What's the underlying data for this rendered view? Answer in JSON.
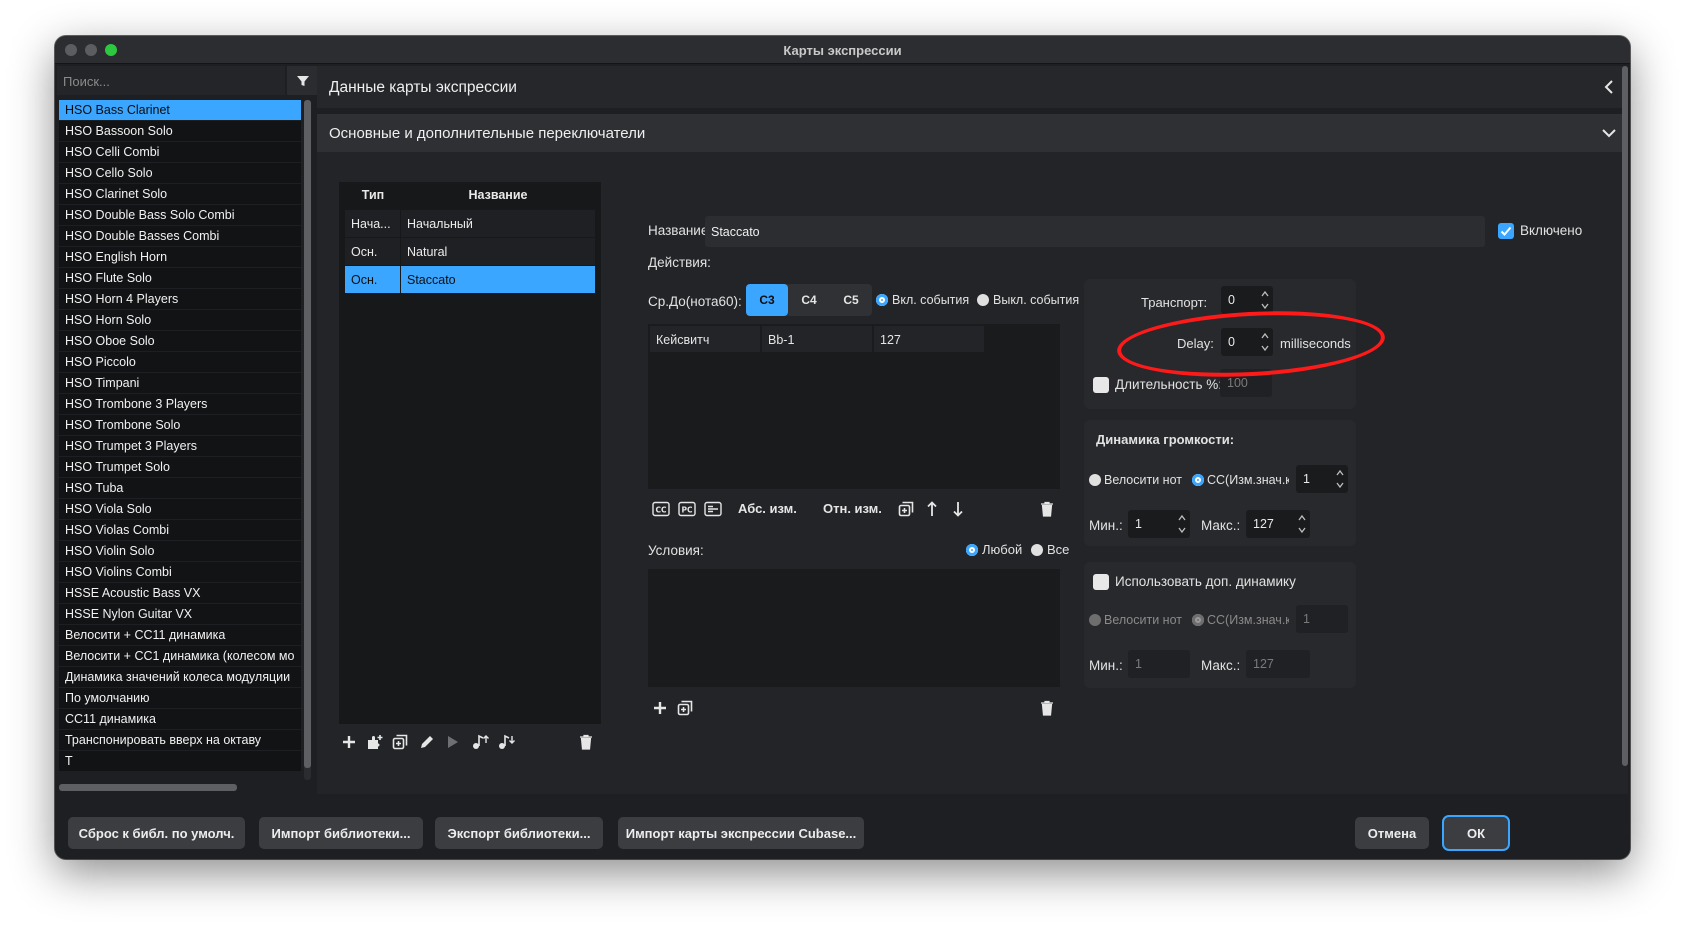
{
  "window": {
    "title": "Карты экспрессии"
  },
  "sidebar": {
    "search_placeholder": "Поиск...",
    "presets": [
      "HSO Bass Clarinet",
      "HSO Bassoon Solo",
      "HSO Celli Combi",
      "HSO Cello Solo",
      "HSO Clarinet Solo",
      "HSO Double Bass Solo Combi",
      "HSO Double Basses Combi",
      "HSO English Horn",
      "HSO Flute Solo",
      "HSO Horn 4 Players",
      "HSO Horn Solo",
      "HSO Oboe Solo",
      "HSO Piccolo",
      "HSO Timpani",
      "HSO Trombone 3 Players",
      "HSO Trombone Solo",
      "HSO Trumpet 3 Players",
      "HSO Trumpet Solo",
      "HSO Tuba",
      "HSO Viola Solo",
      "HSO Violas Combi",
      "HSO Violin Solo",
      "HSO Violins Combi",
      "HSSE Acoustic Bass VX",
      "HSSE Nylon Guitar VX",
      "Велосити + CC11 динамика",
      "Велосити + CC1 динамика (колесом мо",
      "Динамика значений колеса модуляции",
      "По умолчанию",
      "CC11 динамика",
      "Транспонировать вверх на октаву",
      "Т"
    ],
    "selected_index": 0
  },
  "main": {
    "title": "Данные карты экспрессии",
    "section_title": "Основные и дополнительные переключатели"
  },
  "table": {
    "headers": {
      "type": "Тип",
      "name": "Название"
    },
    "rows": [
      {
        "type": "Нача...",
        "name": "Начальный"
      },
      {
        "type": "Осн.",
        "name": "Natural"
      },
      {
        "type": "Осн.",
        "name": "Staccato"
      }
    ],
    "selected_index": 2
  },
  "editor": {
    "name_label": "Название:",
    "name_value": "Staccato",
    "enabled_label": "Включено",
    "enabled": true,
    "actions_label": "Действия:",
    "middle_c_label": "Ср.До(нота60):",
    "octave_options": [
      "C3",
      "C4",
      "C5"
    ],
    "octave_selected": "C3",
    "on_events_label": "Вкл. события",
    "off_events_label": "Выкл. события",
    "action_row": [
      "Кейсвитч",
      "Bb-1",
      "127"
    ],
    "abs_change": "Абс. изм.",
    "rel_change": "Отн. изм.",
    "conditions_label": "Условия:",
    "any_label": "Любой",
    "all_label": "Все"
  },
  "transport": {
    "label": "Транспорт:",
    "value": "0",
    "delay_label": "Delay:",
    "delay_value": "0",
    "delay_unit": "milliseconds",
    "duration_label": "Длительность %:",
    "duration_value": "100"
  },
  "dynamics": {
    "title": "Динамика громкости:",
    "velocity_label": "Велосити нот",
    "cc_label": "CC(Изм.знач.к",
    "cc_value": "1",
    "min_label": "Мин.:",
    "min_value": "1",
    "max_label": "Макс.:",
    "max_value": "127"
  },
  "extra_dynamics": {
    "label": "Использовать доп. динамику",
    "velocity_label": "Велосити нот",
    "cc_label": "CC(Изм.знач.к",
    "cc_value": "1",
    "min_label": "Мин.:",
    "min_value": "1",
    "max_label": "Макс.:",
    "max_value": "127"
  },
  "buttons": {
    "reset": "Сброс к библ. по умолч.",
    "import_lib": "Импорт библиотеки...",
    "export_lib": "Экспорт библиотеки...",
    "import_cubase": "Импорт карты экспрессии Cubase...",
    "cancel": "Отмена",
    "ok": "ОК"
  },
  "colors": {
    "accent": "#3aa6ff",
    "annotation": "#ff1a1a",
    "background": "#1d1f22"
  }
}
